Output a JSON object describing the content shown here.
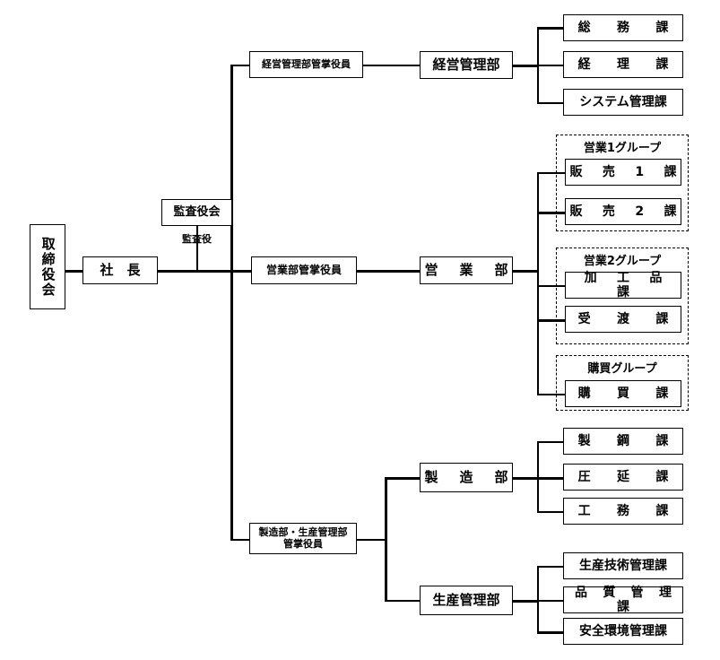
{
  "title": "組織図",
  "colors": {
    "line": "#000000",
    "box_border": "#000000",
    "background": "#ffffff"
  },
  "nodes": {
    "board_of_directors": "取締役会",
    "president": "社　長",
    "audit_board": "監査役会",
    "auditor": "監査役",
    "officer_admin": "経営管理部管掌役員",
    "dept_admin": "経営管理部",
    "sec_general_affairs": "総　務　課",
    "sec_accounting": "経　理　課",
    "sec_system": "システム管理課",
    "officer_sales": "営業部管掌役員",
    "dept_sales": "営　業　部",
    "group_sales1": "営業1グループ",
    "sec_sales1": "販　売　1　課",
    "sec_sales2": "販　売　2　課",
    "group_sales2": "営業2グループ",
    "sec_processed": "加　工　品　課",
    "sec_delivery": "受　渡　課",
    "group_purchasing": "購買グループ",
    "sec_purchasing": "購　買　課",
    "officer_mfg": "製造部・生産管理部\n管掌役員",
    "officer_mfg_line1": "製造部・生産管理部",
    "officer_mfg_line2": "管掌役員",
    "dept_mfg": "製　造　部",
    "sec_steelmaking": "製　鋼　課",
    "sec_rolling": "圧　延　課",
    "sec_engineering": "工　務　課",
    "dept_prod_mgmt": "生産管理部",
    "sec_prod_tech": "生産技術管理課",
    "sec_quality": "品　質　管　理　課",
    "sec_safety_env": "安全環境管理課"
  }
}
